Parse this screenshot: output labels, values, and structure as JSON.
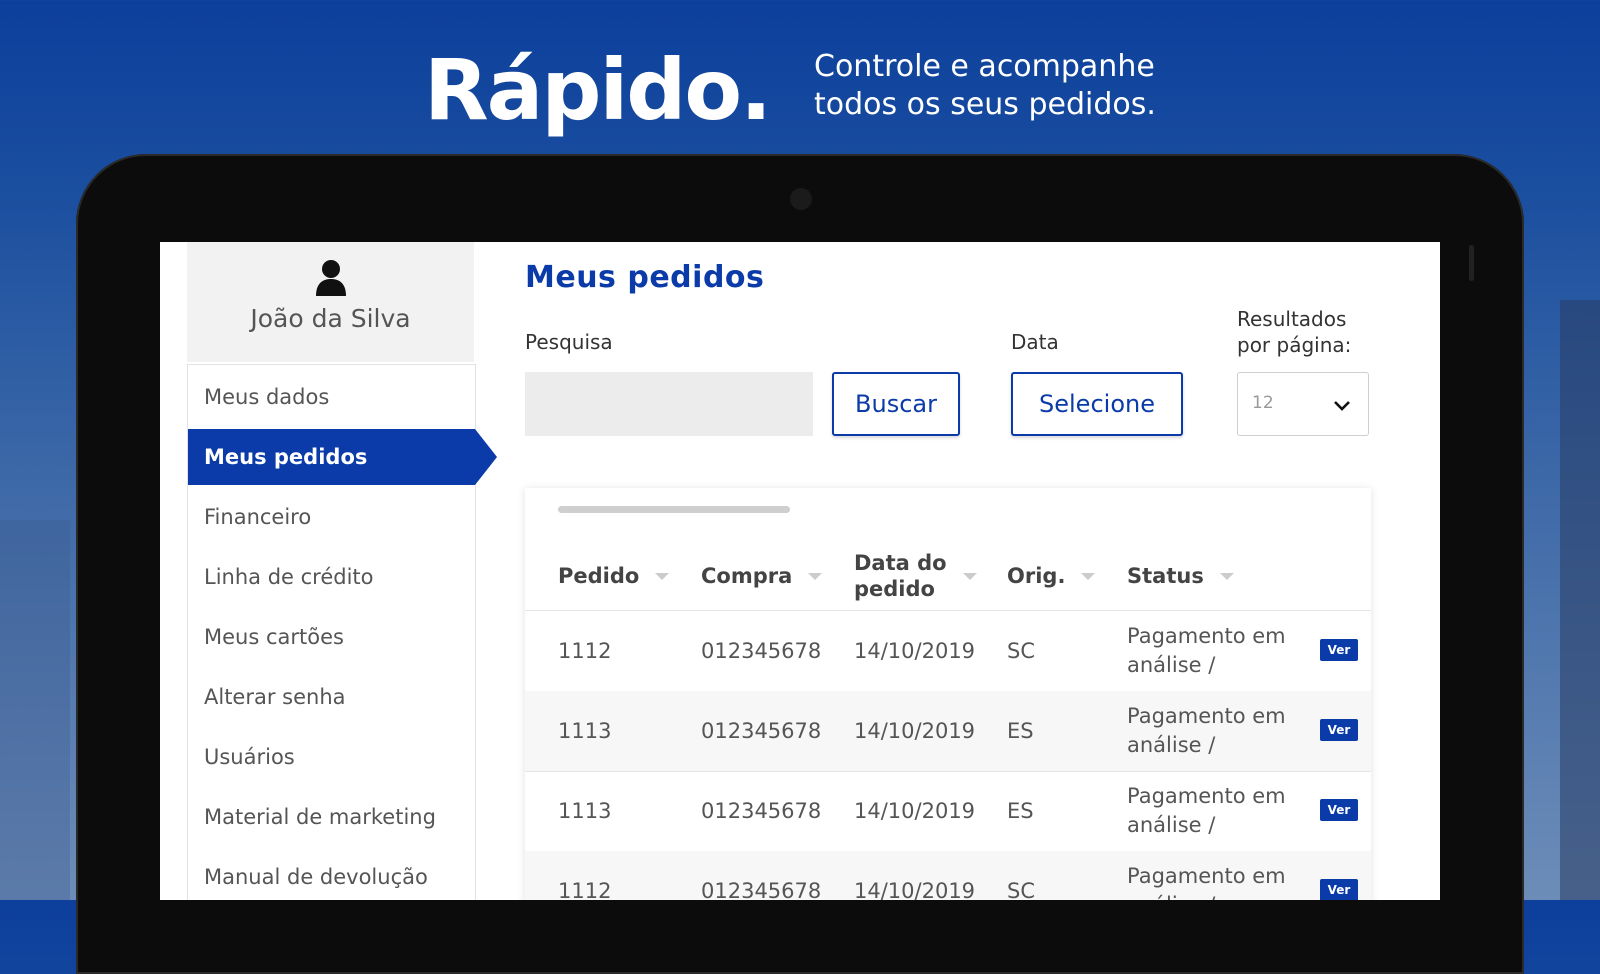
{
  "hero": {
    "title": "Rápido.",
    "subtitle_line1": "Controle e acompanhe",
    "subtitle_line2": "todos os seus pedidos."
  },
  "user": {
    "name": "João da Silva",
    "icon": "user-icon"
  },
  "sidebar": {
    "items": [
      {
        "label": "Meus dados",
        "active": false
      },
      {
        "label": "Meus pedidos",
        "active": true
      },
      {
        "label": "Financeiro",
        "active": false
      },
      {
        "label": "Linha de crédito",
        "active": false
      },
      {
        "label": "Meus cartões",
        "active": false
      },
      {
        "label": "Alterar senha",
        "active": false
      },
      {
        "label": "Usuários",
        "active": false
      },
      {
        "label": "Material de marketing",
        "active": false
      },
      {
        "label": "Manual de devolução",
        "active": false
      }
    ]
  },
  "main": {
    "title": "Meus pedidos",
    "search": {
      "label": "Pesquisa",
      "value": "",
      "button": "Buscar"
    },
    "date": {
      "label": "Data",
      "button": "Selecione"
    },
    "per_page": {
      "label_line1": "Resultados",
      "label_line2": "por página:",
      "value": "12"
    }
  },
  "table": {
    "headers": {
      "pedido": "Pedido",
      "compra": "Compra",
      "data_line1": "Data do",
      "data_line2": "pedido",
      "orig": "Orig.",
      "status": "Status"
    },
    "rows": [
      {
        "pedido": "1112",
        "compra": "012345678",
        "data": "14/10/2019",
        "orig": "SC",
        "status": "Pagamento em análise / Pendente",
        "action": "Ver"
      },
      {
        "pedido": "1113",
        "compra": "012345678",
        "data": "14/10/2019",
        "orig": "ES",
        "status": "Pagamento em análise / Pendente",
        "action": "Ver"
      },
      {
        "pedido": "1113",
        "compra": "012345678",
        "data": "14/10/2019",
        "orig": "ES",
        "status": "Pagamento em análise / Pendente",
        "action": "Ver"
      },
      {
        "pedido": "1112",
        "compra": "012345678",
        "data": "14/10/2019",
        "orig": "SC",
        "status": "Pagamento em análise / Pendente",
        "action": "Ver"
      }
    ]
  },
  "colors": {
    "brand": "#0a3ba8",
    "background": "#1b4f9f"
  }
}
